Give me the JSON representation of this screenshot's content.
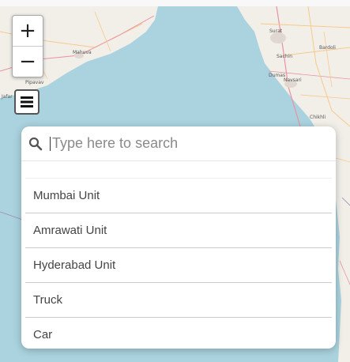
{
  "map": {
    "place_labels": [
      "Surat",
      "Bardoli",
      "Sachin",
      "Navsari",
      "Chikhli",
      "Dumas",
      "Mahuva",
      "Pipavav",
      "Jafar"
    ]
  },
  "zoom": {
    "in_label": "+",
    "out_label": "−"
  },
  "menu": {
    "icon": "hamburger-menu-icon"
  },
  "search": {
    "icon": "search-icon",
    "placeholder": "Type here to search",
    "value": ""
  },
  "results": [
    {
      "label": "Mumbai Unit"
    },
    {
      "label": "Amrawati Unit"
    },
    {
      "label": "Hyderabad Unit"
    },
    {
      "label": "Truck"
    },
    {
      "label": "Car"
    }
  ],
  "colors": {
    "sea": "#aad3df",
    "land": "#f2efe9",
    "panel_bg": "#ffffff",
    "road_major": "#e892a2",
    "road_minor": "#f7c98b"
  }
}
